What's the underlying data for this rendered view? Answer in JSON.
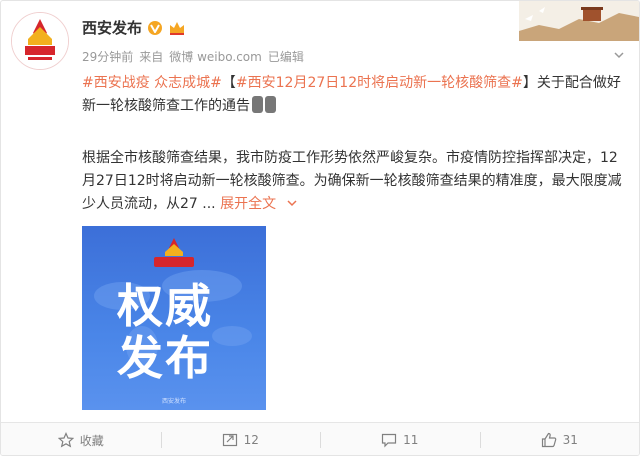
{
  "author": {
    "name": "西安发布",
    "verified": true
  },
  "meta": {
    "time": "29分钟前",
    "source_prefix": "来自",
    "source": "微博 weibo.com",
    "edited": "已编辑"
  },
  "post": {
    "tag1": "#西安战疫 众志成城#",
    "bracket_open": "【",
    "tag2": "#西安12月27日12时将启动新一轮核酸筛查#",
    "bracket_close": "】",
    "headline_rest": "关于配合做好新一轮核酸筛查工作的通告",
    "body": "根据全市核酸筛查结果，我市防疫工作形势依然严峻复杂。市疫情防控指挥部决定，12月27日12时将启动新一轮核酸筛查。为确保新一轮核酸筛查结果的精准度，最大限度减少人员流动，从27 ... ",
    "more": "展开全文"
  },
  "image": {
    "line1": "权威",
    "line2": "发布",
    "logo_text": "西安发布"
  },
  "actions": [
    {
      "label": "收藏",
      "icon": "star-icon"
    },
    {
      "label": "12",
      "icon": "share-icon"
    },
    {
      "label": "11",
      "icon": "comment-icon"
    },
    {
      "label": "31",
      "icon": "like-icon"
    }
  ],
  "colors": {
    "link": "#eb7350",
    "brand_red": "#d6262c",
    "image_blue": "#4a86e8"
  }
}
